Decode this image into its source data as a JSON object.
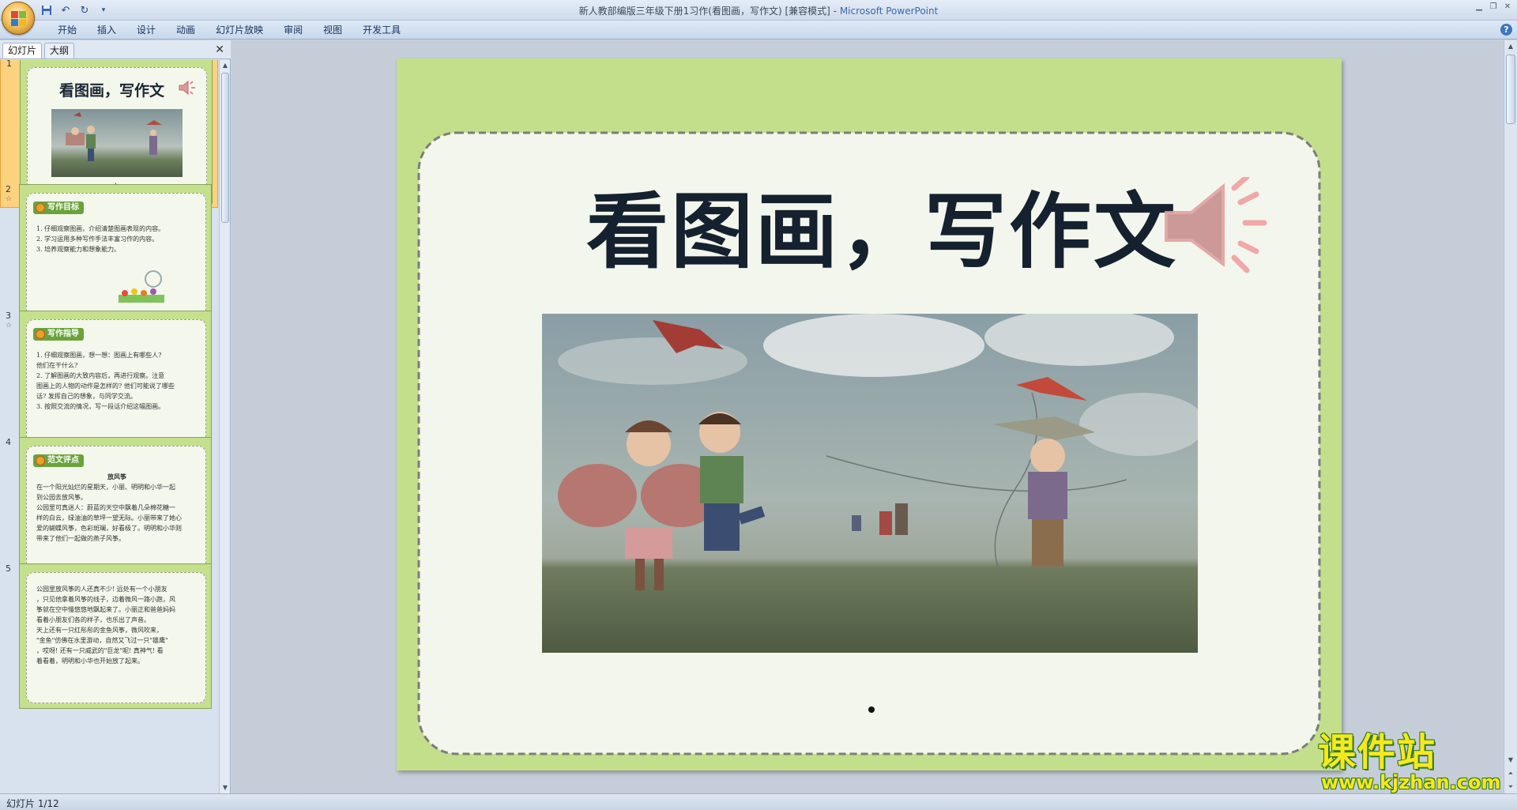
{
  "window": {
    "title": "新人教部编版三年级下册1习作(看图画，写作文) [兼容模式] - ",
    "app_name": "Microsoft PowerPoint"
  },
  "ribbon": {
    "tabs": [
      "开始",
      "插入",
      "设计",
      "动画",
      "幻灯片放映",
      "审阅",
      "视图",
      "开发工具"
    ]
  },
  "left_panel": {
    "tabs": {
      "slides": "幻灯片",
      "outline": "大纲"
    },
    "close_glyph": "✕",
    "thumbnails": [
      {
        "number": "1",
        "title": "看图画，写作文",
        "dot": "."
      },
      {
        "number": "2",
        "badge": "写作目标",
        "lines": [
          "1. 仔细观察图画，介绍清楚图画表现的内容。",
          "2. 学习运用多种写作手法丰富习作的内容。",
          "3. 培养观察能力和想象能力。"
        ]
      },
      {
        "number": "3",
        "badge": "写作指导",
        "lines": [
          "1. 仔细观察图画，想一想：图画上有哪些人?",
          "他们在干什么?",
          "2. 了解图画的大致内容后，再进行观察。注意",
          "图画上的人物的动作是怎样的? 他们可能说了哪些",
          "话? 发挥自己的想象，与同学交流。",
          "3. 按照交流的情况，写一段话介绍这幅图画。"
        ]
      },
      {
        "number": "4",
        "badge": "范文评点",
        "heading": "放风筝",
        "lines": [
          "在一个阳光灿烂的星期天，小丽、明明和小华一起",
          "到公园去放风筝。",
          "公园里可真迷人：蔚蓝的天空中飘着几朵棉花糖一",
          "样的白云，绿油油的草坪一望无际。小丽带来了她心",
          "爱的蝴蝶风筝，色彩斑斓，好看极了。明明和小华则",
          "带来了他们一起做的燕子风筝。"
        ]
      },
      {
        "number": "5",
        "lines": [
          "公园里放风筝的人还真不少! 远处有一个小朋友",
          "，只见他拿着风筝的线子，边着微风一路小跑，风",
          "筝就在空中慢悠悠地飘起来了。小丽正和爸爸妈妈",
          "看着小朋友们各的样子，也乐出了声音。",
          "天上还有一只红彤彤的金鱼风筝，微风吹来，",
          "\"金鱼\"仿佛在水里游动，自然又飞过一只\"雄鹰\"",
          "，哎呀! 还有一只威武的\"巨龙\"呢! 真神气! 看",
          "着看着，明明和小华也开始放了起来。"
        ]
      }
    ]
  },
  "slide": {
    "title": "看图画，写作文"
  },
  "status_bar": {
    "text": "幻灯片 1/12"
  },
  "watermark": {
    "name": "课件站",
    "url": "www.kjzhan.com"
  },
  "colors": {
    "slide_green": "#c3df8b",
    "selected_thumb": "#fcd27f",
    "badge_green": "#6aa33a",
    "watermark_yellow": "#f7e81d"
  }
}
